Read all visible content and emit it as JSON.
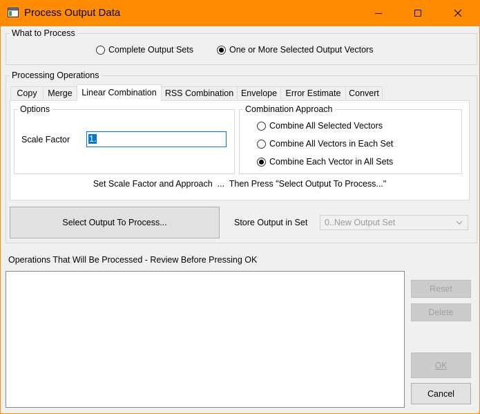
{
  "window": {
    "title": "Process Output Data"
  },
  "what_to_process": {
    "legend": "What to Process",
    "options": [
      {
        "label": "Complete Output Sets",
        "checked": false
      },
      {
        "label": "One or More Selected Output Vectors",
        "checked": true
      }
    ]
  },
  "processing": {
    "legend": "Processing Operations",
    "tabs": [
      {
        "label": "Copy",
        "active": false
      },
      {
        "label": "Merge",
        "active": false
      },
      {
        "label": "Linear Combination",
        "active": true
      },
      {
        "label": "RSS Combination",
        "active": false
      },
      {
        "label": "Envelope",
        "active": false
      },
      {
        "label": "Error Estimate",
        "active": false
      },
      {
        "label": "Convert",
        "active": false
      }
    ],
    "options_legend": "Options",
    "scale_factor_label": "Scale Factor",
    "scale_factor_value": "1.",
    "approach_legend": "Combination Approach",
    "approach_options": [
      {
        "label": "Combine All Selected Vectors",
        "checked": false
      },
      {
        "label": "Combine All Vectors in Each Set",
        "checked": false
      },
      {
        "label": "Combine Each Vector in All Sets",
        "checked": true
      }
    ],
    "hint": "Set Scale Factor and Approach  ...  Then Press \"Select Output To Process...\""
  },
  "select_output_button": "Select Output To Process...",
  "store_output": {
    "label": "Store Output in Set",
    "value": "0..New Output Set"
  },
  "operations_label": "Operations That Will Be Processed - Review Before Pressing OK",
  "buttons": {
    "reset": "Reset",
    "delete": "Delete",
    "ok": "OK",
    "cancel": "Cancel"
  }
}
